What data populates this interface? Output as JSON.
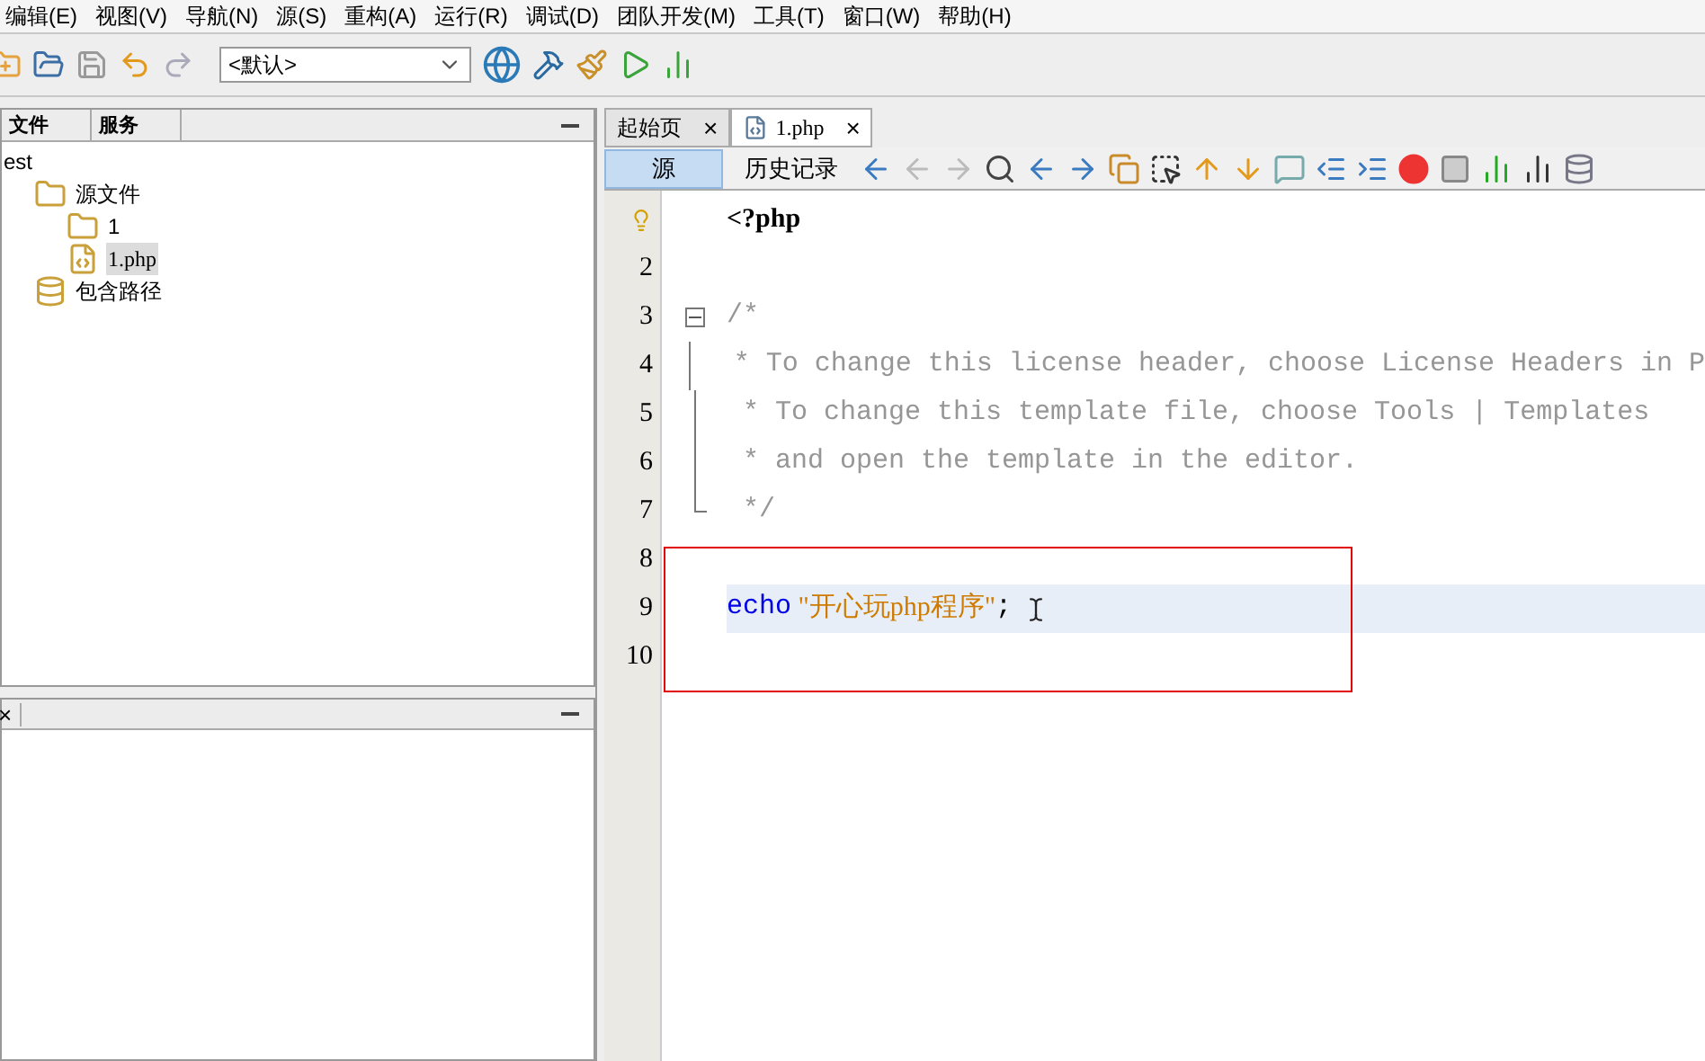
{
  "menu": [
    "编辑(E)",
    "视图(V)",
    "导航(N)",
    "源(S)",
    "重构(A)",
    "运行(R)",
    "调试(D)",
    "团队开发(M)",
    "工具(T)",
    "窗口(W)",
    "帮助(H)"
  ],
  "toolbar": {
    "config": "<默认>"
  },
  "left_panel": {
    "tabs": [
      {
        "label": "文件"
      },
      {
        "label": "服务"
      }
    ],
    "tree": [
      {
        "label": "est",
        "selected": false,
        "children": [
          {
            "label": "源文件",
            "kind": "folder",
            "selected": false,
            "children": [
              {
                "label": "1",
                "kind": "folder",
                "selected": false
              },
              {
                "label": "1.php",
                "kind": "file",
                "selected": true
              }
            ]
          },
          {
            "label": "包含路径",
            "kind": "library",
            "selected": false
          }
        ]
      }
    ]
  },
  "bottom_panel": {
    "close": "×"
  },
  "editor_tabs": [
    {
      "label": "起始页",
      "selected": false,
      "close": "×"
    },
    {
      "label": "1.php",
      "selected": true,
      "close": "×"
    }
  ],
  "view_toggle": [
    {
      "label": "源",
      "selected": true
    },
    {
      "label": "历史记录",
      "selected": false
    }
  ],
  "code": [
    {
      "hint": true,
      "current": false,
      "kind": "plain",
      "tokens": [
        {
          "text": "<?php",
          "kind": "tag"
        }
      ]
    },
    {
      "number": "2",
      "hint": false,
      "current": false,
      "kind": "plain"
    },
    {
      "number": "3",
      "hint": false,
      "current": false,
      "kind": "start",
      "tokens": [
        {
          "text": "/*",
          "kind": "comment"
        }
      ]
    },
    {
      "number": "4",
      "hint": false,
      "current": false,
      "kind": "body",
      "tokens": [
        {
          "text": " * To change this license header, choose License Headers in P",
          "kind": "comment"
        }
      ]
    },
    {
      "number": "5",
      "hint": false,
      "current": false,
      "kind": "body",
      "tokens": [
        {
          "text": " * To change this template file, choose Tools | Templates",
          "kind": "comment"
        }
      ]
    },
    {
      "number": "6",
      "hint": false,
      "current": false,
      "kind": "body",
      "tokens": [
        {
          "text": " * and open the template in the editor.",
          "kind": "comment"
        }
      ]
    },
    {
      "number": "7",
      "hint": false,
      "current": false,
      "kind": "end",
      "tokens": [
        {
          "text": " */",
          "kind": "comment"
        }
      ]
    },
    {
      "number": "8",
      "hint": false,
      "current": false,
      "kind": "plain"
    },
    {
      "number": "9",
      "hint": false,
      "current": true,
      "kind": "plain",
      "tokens": [
        {
          "text": "echo",
          "kind": "keyword"
        },
        {
          "text": " \"开心玩php程序\"",
          "kind": "string"
        },
        {
          "text": ";",
          "kind": "plain"
        }
      ]
    },
    {
      "number": "10",
      "hint": false,
      "current": false,
      "kind": "plain"
    }
  ]
}
